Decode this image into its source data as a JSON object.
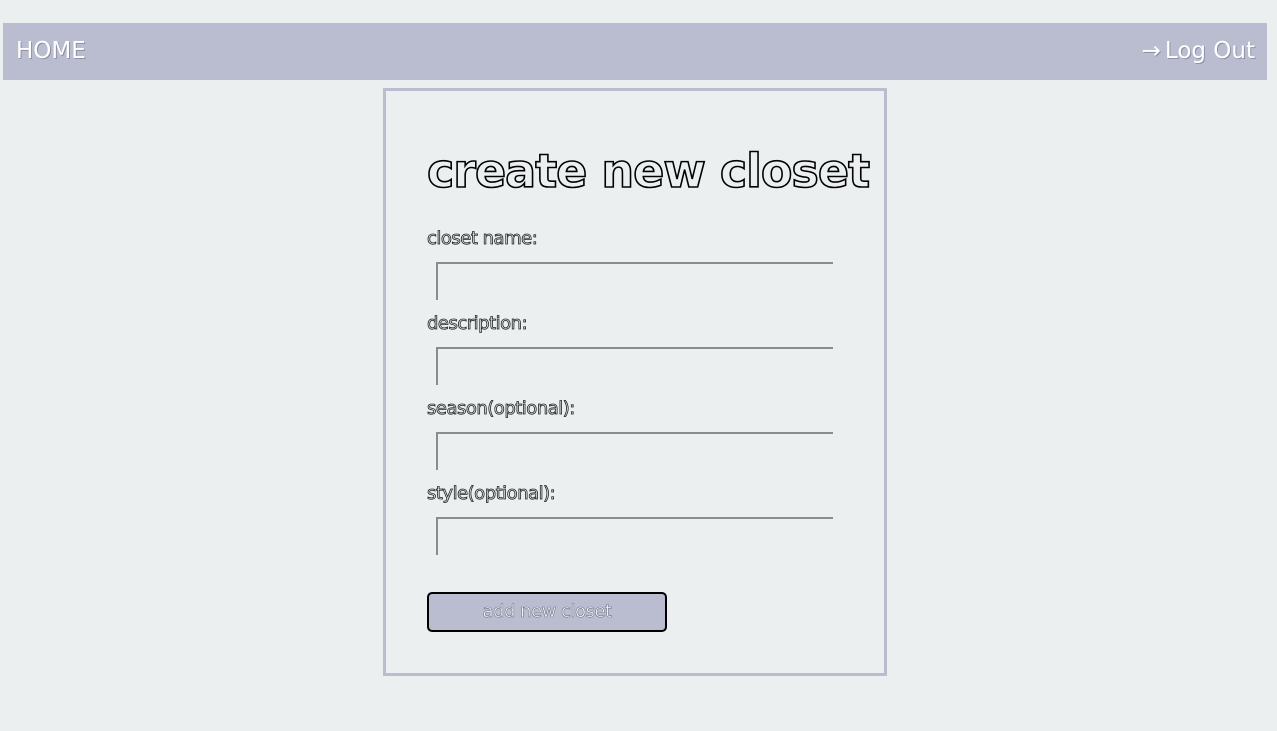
{
  "nav": {
    "home_label": "HOME",
    "logout_arrow": "→",
    "logout_label": "Log Out"
  },
  "form": {
    "title": "create new closet",
    "fields": [
      {
        "label": "closet name:",
        "value": ""
      },
      {
        "label": "description:",
        "value": ""
      },
      {
        "label": "season(optional):",
        "value": ""
      },
      {
        "label": "style(optional):",
        "value": ""
      }
    ],
    "submit_label": "add new closet"
  },
  "colors": {
    "background": "#ebeff0",
    "accent": "#babdcf",
    "input_border": "#8c8c8c"
  }
}
